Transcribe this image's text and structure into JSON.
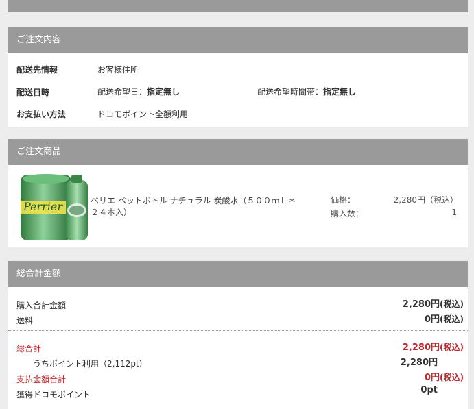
{
  "order": {
    "title": "ご注文内容",
    "delivery_info_label": "配送先情報",
    "delivery_info_value": "お客様住所",
    "delivery_date_label": "配送日時",
    "date_prefix": "配送希望日：",
    "date_value": "指定無し",
    "time_prefix": "配送希望時間帯：",
    "time_value": "指定無し",
    "payment_label": "お支払い方法",
    "payment_value": "ドコモポイント全額利用"
  },
  "product": {
    "title": "ご注文商品",
    "name": "ペリエ ペットボトル ナチュラル 炭酸水（５００ｍＬ＊２４本入）",
    "image_text": "Perrier",
    "price_label": "価格：",
    "price_value": "2,280円（税込）",
    "qty_label": "購入数：",
    "qty_value": "1"
  },
  "totals": {
    "title": "総合計金額",
    "purchase_total_label": "購入合計金額",
    "purchase_total_value": "2,280円",
    "purchase_total_tax": "(税込)",
    "shipping_label": "送料",
    "shipping_value": "0円",
    "shipping_tax": "(税込)",
    "grand_total_label": "総合計",
    "grand_total_value": "2,280円",
    "grand_total_tax": "(税込)",
    "points_used_label": "うちポイント利用（2,112pt）",
    "points_used_value": "2,280円",
    "payment_total_label": "支払金額合計",
    "payment_total_value": "0円",
    "payment_total_tax": "(税込)",
    "earned_points_label": "獲得ドコモポイント",
    "earned_points_value": "0pt"
  },
  "colors": {
    "header_gray": "#9a9a9a",
    "accent_red": "#c1272d",
    "bottle_green": "#3f8f4f"
  }
}
